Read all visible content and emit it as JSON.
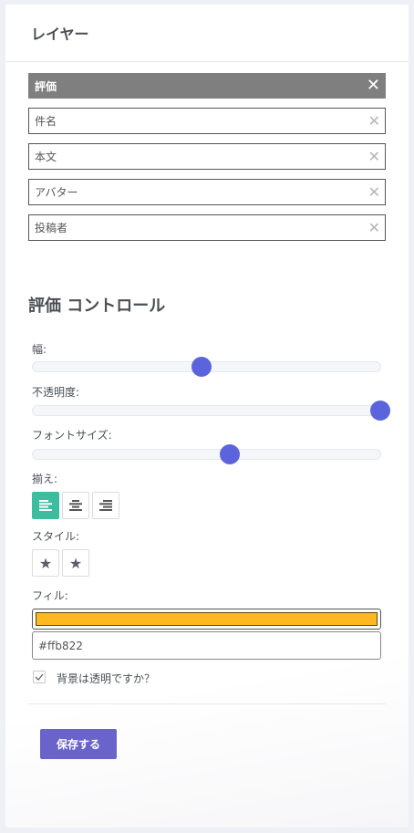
{
  "header": {
    "title": "レイヤー"
  },
  "layers": [
    {
      "label": "評価",
      "active": true
    },
    {
      "label": "件名",
      "active": false
    },
    {
      "label": "本文",
      "active": false
    },
    {
      "label": "アバター",
      "active": false
    },
    {
      "label": "投稿者",
      "active": false
    }
  ],
  "controls": {
    "title": "評価 コントロール",
    "width": {
      "label": "幅:",
      "value": 0.485
    },
    "opacity": {
      "label": "不透明度:",
      "value": 1.0
    },
    "font_size": {
      "label": "フォントサイズ:",
      "value": 0.568
    },
    "align": {
      "label": "揃え:",
      "options": [
        "left",
        "center",
        "right"
      ],
      "selected": "left"
    },
    "style": {
      "label": "スタイル:",
      "icons": [
        "star-icon",
        "star-icon"
      ]
    },
    "fill": {
      "label": "フィル:",
      "color": "#ffb822",
      "hex_value": "#ffb822"
    },
    "transparent_bg": {
      "label": "背景は透明ですか？",
      "checked": true
    }
  },
  "actions": {
    "save_label": "保存する"
  },
  "colors": {
    "accent": "#5b64dc",
    "align_active": "#3dbd9f",
    "save_button": "#6a63c9",
    "layer_active_bg": "#7f7f7f"
  }
}
